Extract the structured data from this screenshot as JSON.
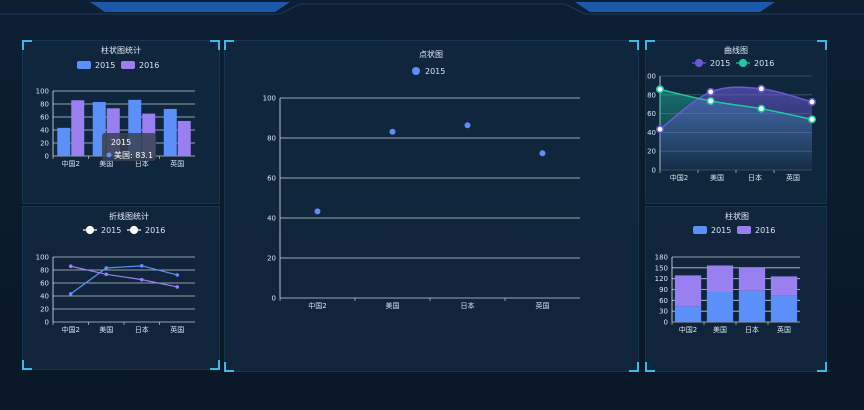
{
  "colors": {
    "blue": "#5b8ff9",
    "purple": "#9a7ff0",
    "teal": "#1fc9a3",
    "violet": "#6a5ad8",
    "grid": "#dfe7f0"
  },
  "panels": {
    "bar": {
      "title": "柱状图统计"
    },
    "line": {
      "title": "折线图统计"
    },
    "scatter": {
      "title": "点状图"
    },
    "curve": {
      "title": "曲线图"
    },
    "stack": {
      "title": "柱状图"
    }
  },
  "tooltip": {
    "title": "2015",
    "row": "美国: 83.1"
  },
  "chart_data": [
    {
      "id": "bar",
      "type": "bar",
      "title": "柱状图统计",
      "categories": [
        "中国2",
        "美国",
        "日本",
        "英国"
      ],
      "series": [
        {
          "name": "2015",
          "values": [
            43.3,
            83.1,
            86.4,
            72.4
          ]
        },
        {
          "name": "2016",
          "values": [
            85.8,
            73.4,
            65.2,
            53.9
          ]
        }
      ],
      "ylim": [
        0,
        100
      ],
      "yticks": [
        0,
        20,
        40,
        60,
        80,
        100
      ]
    },
    {
      "id": "line",
      "type": "line",
      "title": "折线图统计",
      "categories": [
        "中国2",
        "美国",
        "日本",
        "英国"
      ],
      "series": [
        {
          "name": "2015",
          "values": [
            43.3,
            83.1,
            86.4,
            72.4
          ]
        },
        {
          "name": "2016",
          "values": [
            85.8,
            73.4,
            65.2,
            53.9
          ]
        }
      ],
      "ylim": [
        0,
        100
      ],
      "yticks": [
        0,
        20,
        40,
        60,
        80,
        100
      ]
    },
    {
      "id": "scatter",
      "type": "scatter",
      "title": "点状图",
      "categories": [
        "中国2",
        "美国",
        "日本",
        "英国"
      ],
      "series": [
        {
          "name": "2015",
          "values": [
            43.3,
            83.1,
            86.4,
            72.4
          ]
        }
      ],
      "ylim": [
        0,
        100
      ],
      "yticks": [
        0,
        20,
        40,
        60,
        80,
        100
      ]
    },
    {
      "id": "curve",
      "type": "line",
      "title": "曲线图",
      "categories": [
        "中国2",
        "美国",
        "日本",
        "英国"
      ],
      "series": [
        {
          "name": "2015",
          "values": [
            43.3,
            83.1,
            86.4,
            72.4
          ]
        },
        {
          "name": "2016",
          "values": [
            85.8,
            73.4,
            65.2,
            53.9
          ]
        }
      ],
      "ylim": [
        0,
        100
      ],
      "yticks": [
        0,
        20,
        40,
        60,
        80,
        100
      ]
    },
    {
      "id": "stack",
      "type": "bar",
      "title": "柱状图",
      "categories": [
        "中国2",
        "美国",
        "日本",
        "英国"
      ],
      "series": [
        {
          "name": "2015",
          "values": [
            43.3,
            83.1,
            86.4,
            72.4
          ]
        },
        {
          "name": "2016",
          "values": [
            85.8,
            73.4,
            65.2,
            53.9
          ]
        }
      ],
      "ylim": [
        0,
        180
      ],
      "yticks": [
        0,
        30,
        60,
        90,
        120,
        150,
        180
      ]
    }
  ]
}
